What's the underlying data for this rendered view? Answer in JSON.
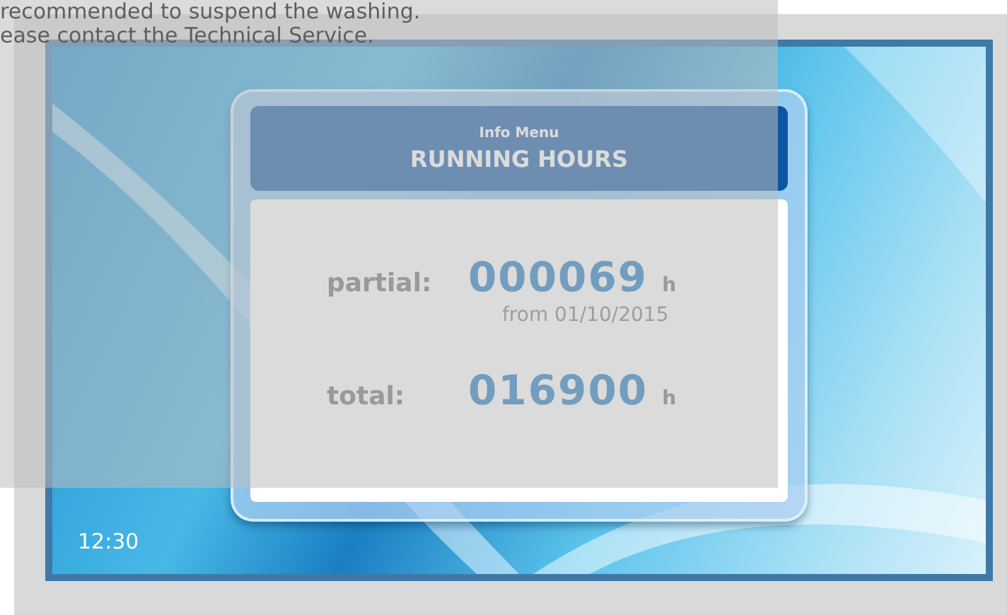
{
  "notice": {
    "lines": [
      "recommended to suspend the washing.",
      "ease contact the Technical Service."
    ]
  },
  "dialog": {
    "subtitle": "Info Menu",
    "title": "RUNNING HOURS",
    "rows": [
      {
        "label": "partial:",
        "value": "000069",
        "unit": "h",
        "note": "from 01/10/2015"
      },
      {
        "label": "total:",
        "value": "016900",
        "unit": "h"
      }
    ]
  },
  "clock": "12:30"
}
